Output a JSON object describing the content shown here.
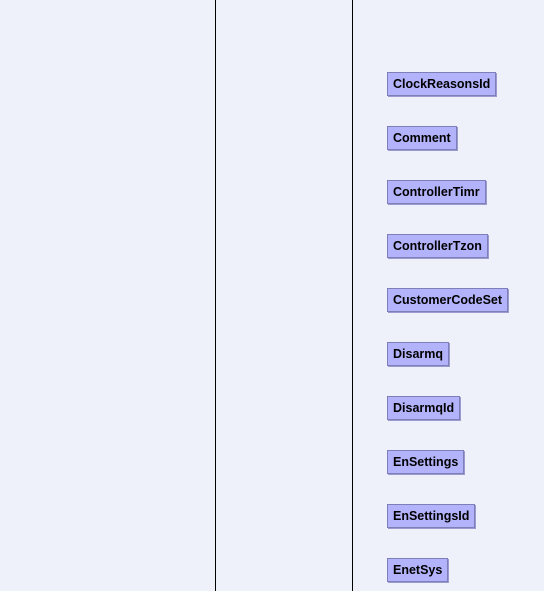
{
  "class_list": {
    "items": [
      {
        "label": "ClockReasonsId"
      },
      {
        "label": "Comment"
      },
      {
        "label": "ControllerTimr"
      },
      {
        "label": "ControllerTzon"
      },
      {
        "label": "CustomerCodeSet"
      },
      {
        "label": "Disarmq"
      },
      {
        "label": "DisarmqId"
      },
      {
        "label": "EnSettings"
      },
      {
        "label": "EnSettingsId"
      },
      {
        "label": "EnetSys"
      }
    ]
  },
  "colors": {
    "background": "#eef0fa",
    "item_fill": "#b3b3fb",
    "item_border": "#7e7eb8",
    "divider": "#000000"
  }
}
